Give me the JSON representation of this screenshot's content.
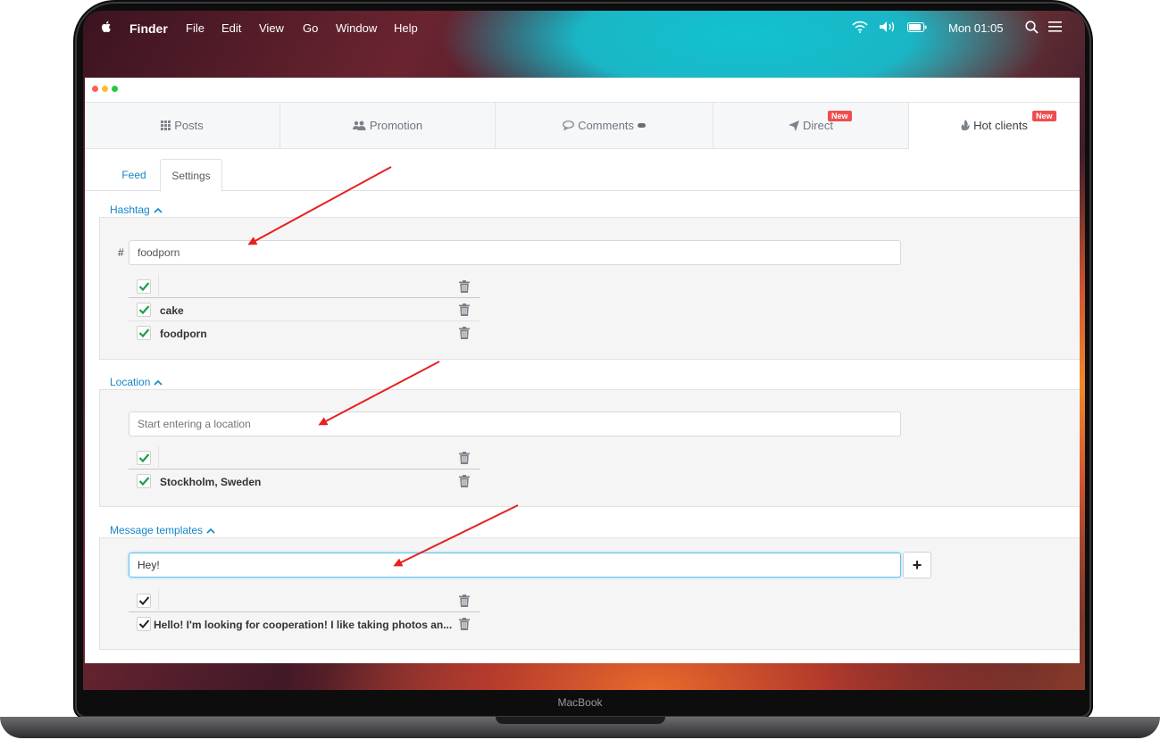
{
  "device": {
    "brand_label": "MacBook"
  },
  "menubar": {
    "app_name": "Finder",
    "menus": [
      "File",
      "Edit",
      "View",
      "Go",
      "Window",
      "Help"
    ],
    "clock": "Mon 01:05",
    "icons": [
      "apple-icon",
      "wifi-icon",
      "volume-icon",
      "battery-icon",
      "search-icon",
      "list-icon"
    ]
  },
  "colors": {
    "accent": "#1486c9",
    "badge": "#f04e4e",
    "check": "#1aa04a",
    "arrow": "#e8201f"
  },
  "tabs": [
    {
      "label": "Posts",
      "icon": "grid-icon",
      "badge": ""
    },
    {
      "label": "Promotion",
      "icon": "users-icon",
      "badge": ""
    },
    {
      "label": "Comments",
      "icon": "comment-icon",
      "badge": ""
    },
    {
      "label": "Direct",
      "icon": "send-icon",
      "badge": "New"
    },
    {
      "label": "Hot clients",
      "icon": "fire-icon",
      "badge": "New"
    }
  ],
  "subtabs": {
    "feed": "Feed",
    "settings": "Settings"
  },
  "hashtag": {
    "title": "Hashtag",
    "prefix": "#",
    "input_value": "foodporn",
    "items": [
      "cake",
      "foodporn"
    ]
  },
  "location": {
    "title": "Location",
    "placeholder": "Start entering a location",
    "items": [
      "Stockholm, Sweden"
    ]
  },
  "templates": {
    "title": "Message templates",
    "input_value": "Hey!",
    "add_label": "+",
    "items": [
      "Hello! I'm looking for cooperation! I like taking photos an..."
    ]
  }
}
